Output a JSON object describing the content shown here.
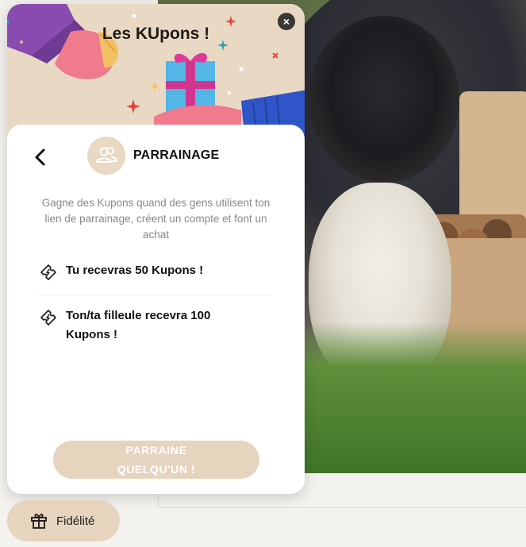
{
  "widget": {
    "hero_title": "Les KUpons !",
    "close_glyph": "×",
    "section_title": "PARRAINAGE",
    "description": "Gagne des Kupons quand des gens utilisent ton lien de parrainage, créent un compte et font un achat",
    "rewards": [
      {
        "icon": "ticket-icon",
        "text": "Tu recevras 50 Kupons !"
      },
      {
        "icon": "ticket-icon",
        "text": "Ton/ta filleule recevra 100 Kupons !"
      }
    ],
    "cta_line1": "PARRAINE",
    "cta_line2": "QUELQU'UN !"
  },
  "launcher": {
    "label": "Fidélité",
    "icon": "gift-icon"
  },
  "colors": {
    "accent": "#e6d4bf",
    "hero_bg": "#e8d8c4",
    "text_dark": "#111111",
    "text_muted": "#8a8886"
  },
  "icons": {
    "back": "chevron-left-icon",
    "section": "users-icon",
    "close": "close-icon"
  }
}
